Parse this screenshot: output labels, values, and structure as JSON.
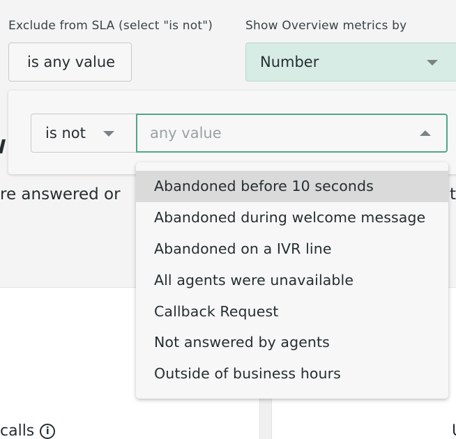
{
  "filters": {
    "exclude_sla": {
      "label": "Exclude from SLA (select \"is not\")",
      "value": "is any value"
    },
    "overview_metrics": {
      "label": "Show Overview metrics by",
      "value": "Number"
    }
  },
  "popover": {
    "operator": "is not",
    "value_placeholder": "any value"
  },
  "dropdown": {
    "options": [
      "Abandoned before 10 seconds",
      "Abandoned during welcome message",
      "Abandoned on a IVR line",
      "All agents were unavailable",
      "Callback Request",
      "Not answered by agents",
      "Outside of business hours"
    ],
    "highlighted_index": 0
  },
  "background": {
    "heading_fragment": "W",
    "subtext_fragment_left": "re answered or",
    "subtext_fragment_right": "t",
    "calls_label": "calls",
    "info_glyph": "i",
    "right_fragment": "U"
  },
  "colors": {
    "accent_green": "#4fa58a",
    "select_green_bg": "#d6ece5",
    "highlight_row": "#dadada"
  }
}
